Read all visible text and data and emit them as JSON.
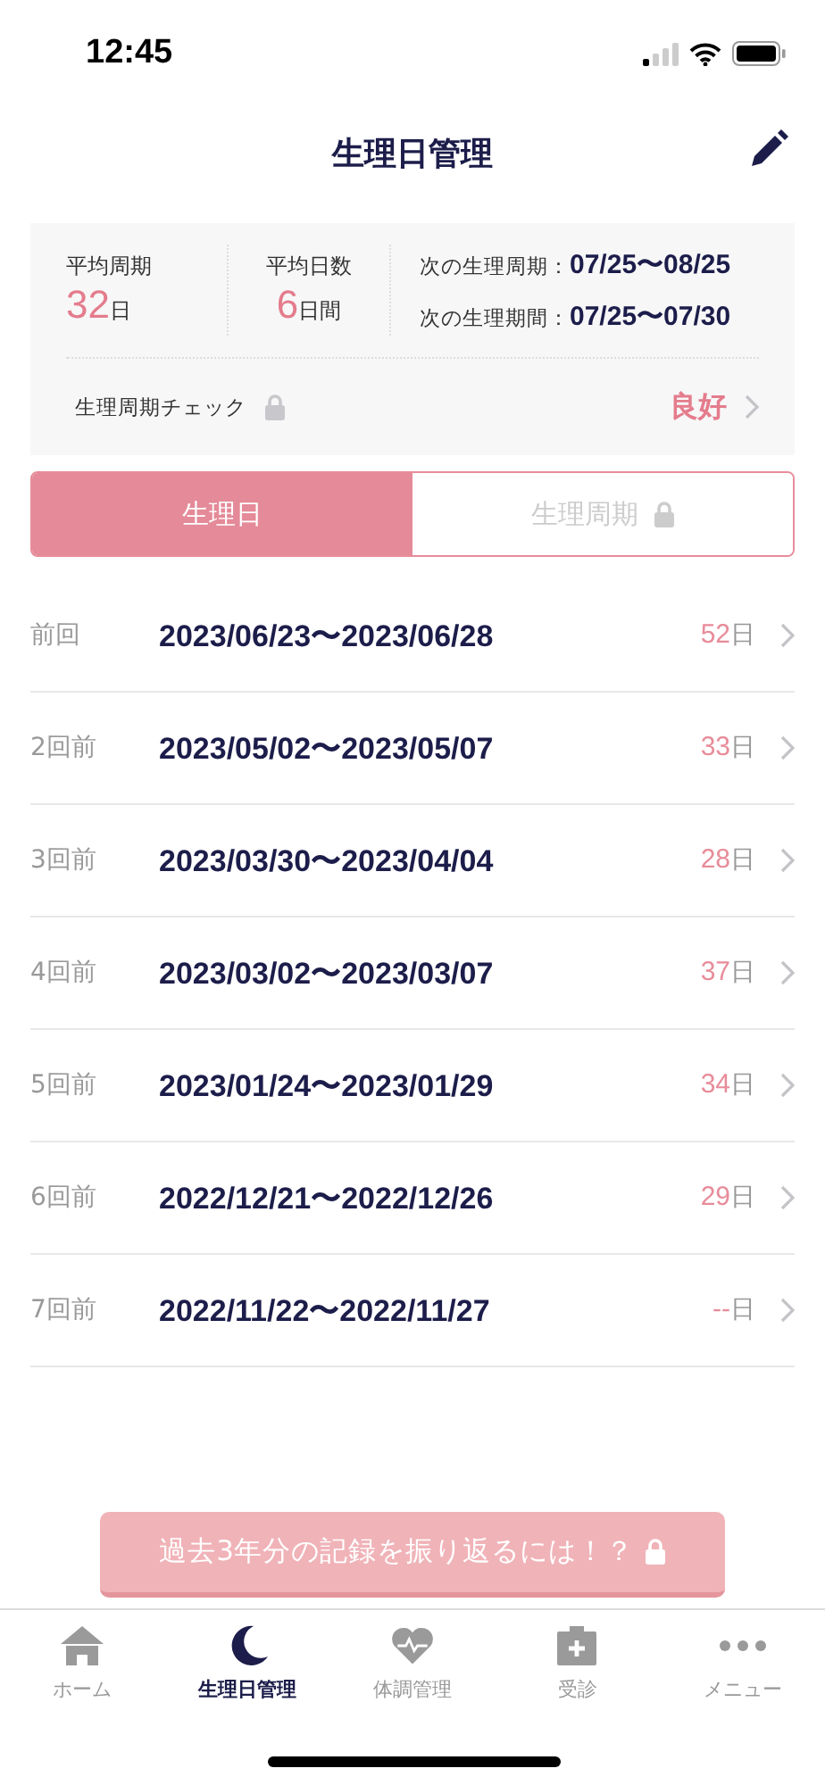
{
  "status_bar": {
    "time": "12:45"
  },
  "header": {
    "title": "生理日管理"
  },
  "summary": {
    "stats": [
      {
        "label": "平均周期",
        "value": "32",
        "unit": "日"
      },
      {
        "label": "平均日数",
        "value": "6",
        "unit": "日間"
      }
    ],
    "next": [
      {
        "label": "次の生理周期：",
        "value": "07/25〜08/25"
      },
      {
        "label": "次の生理期間：",
        "value": "07/25〜07/30"
      }
    ],
    "check": {
      "label": "生理周期チェック",
      "locked": true,
      "result": "良好"
    }
  },
  "tabs": [
    {
      "label": "生理日",
      "selected": true,
      "locked": false
    },
    {
      "label": "生理周期",
      "selected": false,
      "locked": true
    }
  ],
  "records": [
    {
      "label": "前回",
      "range": "2023/06/23〜2023/06/28",
      "days": "52",
      "unit": "日"
    },
    {
      "label": "2回前",
      "range": "2023/05/02〜2023/05/07",
      "days": "33",
      "unit": "日"
    },
    {
      "label": "3回前",
      "range": "2023/03/30〜2023/04/04",
      "days": "28",
      "unit": "日"
    },
    {
      "label": "4回前",
      "range": "2023/03/02〜2023/03/07",
      "days": "37",
      "unit": "日"
    },
    {
      "label": "5回前",
      "range": "2023/01/24〜2023/01/29",
      "days": "34",
      "unit": "日"
    },
    {
      "label": "6回前",
      "range": "2022/12/21〜2022/12/26",
      "days": "29",
      "unit": "日"
    },
    {
      "label": "7回前",
      "range": "2022/11/22〜2022/11/27",
      "days": "--",
      "unit": "日"
    }
  ],
  "promo_button": {
    "label": "過去3年分の記録を振り返るには！？",
    "locked": true
  },
  "nav": [
    {
      "label": "ホーム",
      "kind": "home",
      "selected": false
    },
    {
      "label": "生理日管理",
      "kind": "moon",
      "selected": true
    },
    {
      "label": "体調管理",
      "kind": "health",
      "selected": false
    },
    {
      "label": "受診",
      "kind": "clinic",
      "selected": false
    },
    {
      "label": "メニュー",
      "kind": "more",
      "selected": false
    }
  ]
}
